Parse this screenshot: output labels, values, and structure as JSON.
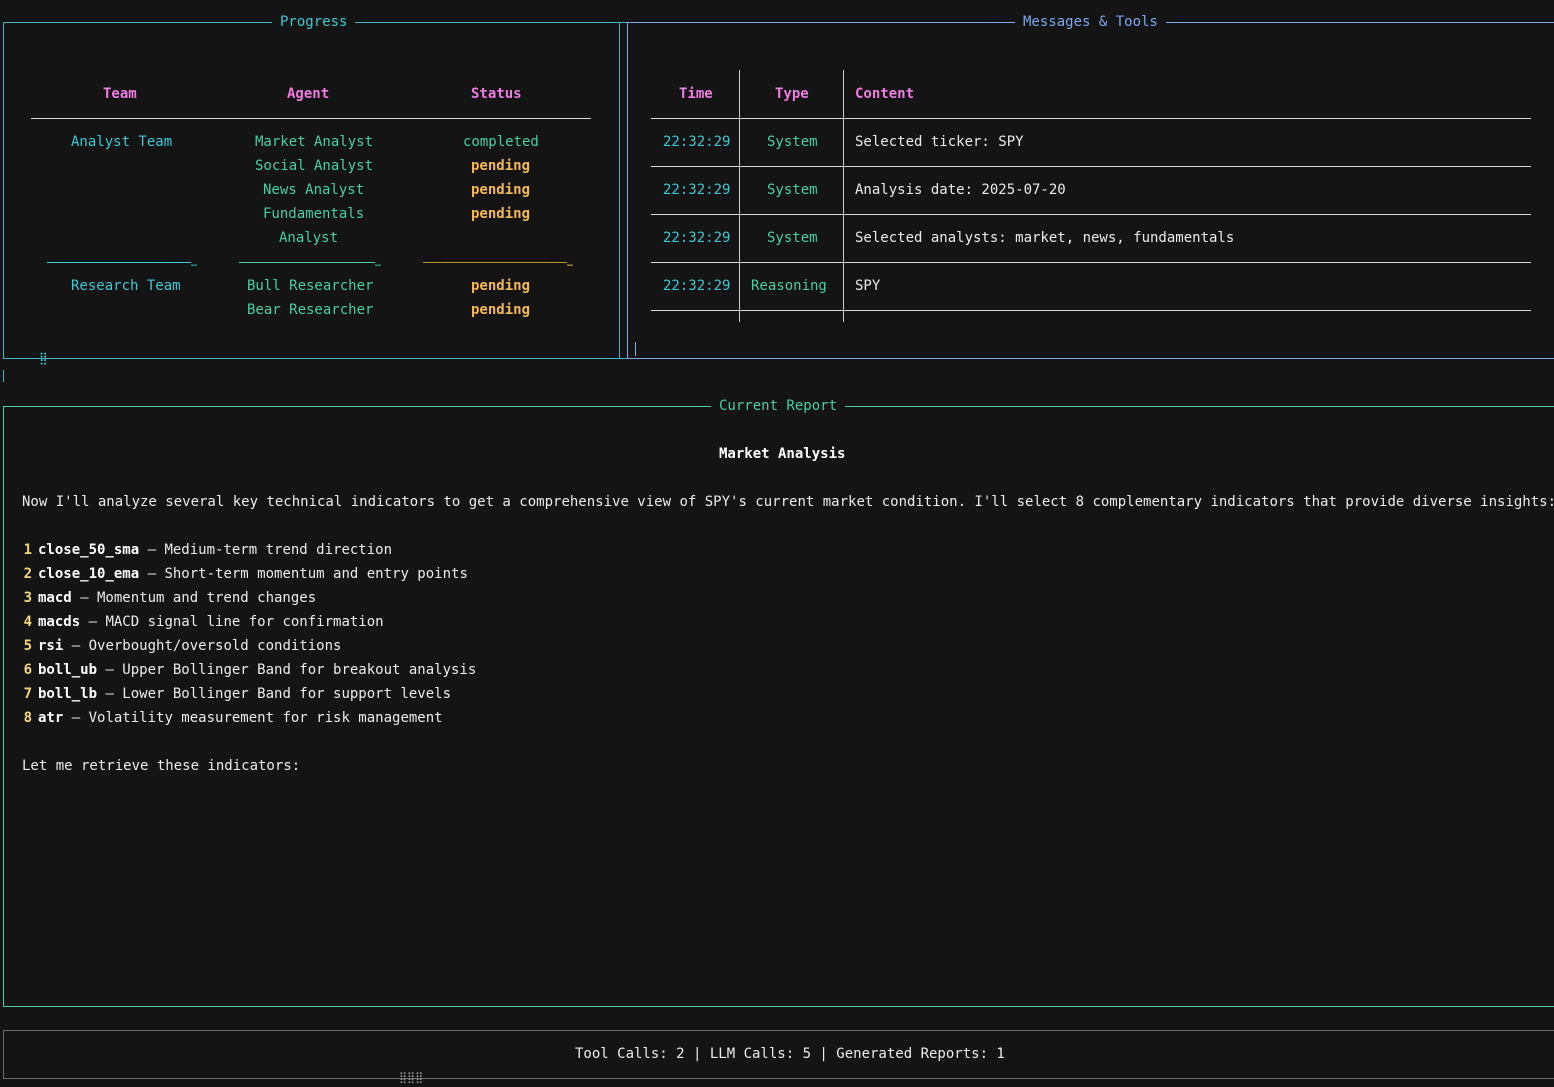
{
  "progress": {
    "title": "Progress",
    "headers": {
      "team": "Team",
      "agent": "Agent",
      "status": "Status"
    },
    "analyst_team": "Analyst Team",
    "research_team": "Research Team",
    "agents": [
      {
        "name": "Market Analyst",
        "status": "completed"
      },
      {
        "name": "Social Analyst",
        "status": "pending"
      },
      {
        "name": "News Analyst",
        "status": "pending"
      },
      {
        "name": "Fundamentals",
        "name2": "Analyst",
        "status": "pending"
      },
      {
        "name": "Bull Researcher",
        "status": "pending"
      },
      {
        "name": "Bear Researcher",
        "status": "pending"
      }
    ],
    "ellipsis": "…",
    "spinner": "⣿"
  },
  "messages": {
    "title": "Messages & Tools",
    "headers": {
      "time": "Time",
      "type": "Type",
      "content": "Content"
    },
    "rows": [
      {
        "time": "22:32:29",
        "type": "System",
        "content": "Selected ticker: SPY"
      },
      {
        "time": "22:32:29",
        "type": "System",
        "content": "Analysis date: 2025-07-20"
      },
      {
        "time": "22:32:29",
        "type": "System",
        "content": "Selected analysts: market, news, fundamentals"
      },
      {
        "time": "22:32:29",
        "type": "Reasoning",
        "content": "SPY"
      }
    ]
  },
  "report": {
    "title": "Current Report",
    "heading": "Market Analysis",
    "intro": "Now I'll analyze several key technical indicators to get a comprehensive view of SPY's current market condition. I'll select 8 complementary indicators that provide diverse insights:",
    "items": [
      {
        "num": "1",
        "key": "close_50_sma",
        "desc": " – Medium-term trend direction"
      },
      {
        "num": "2",
        "key": "close_10_ema",
        "desc": " – Short-term momentum and entry points"
      },
      {
        "num": "3",
        "key": "macd",
        "desc": " – Momentum and trend changes"
      },
      {
        "num": "4",
        "key": "macds",
        "desc": " – MACD signal line for confirmation"
      },
      {
        "num": "5",
        "key": "rsi",
        "desc": " – Overbought/oversold conditions"
      },
      {
        "num": "6",
        "key": "boll_ub",
        "desc": " – Upper Bollinger Band for breakout analysis"
      },
      {
        "num": "7",
        "key": "boll_lb",
        "desc": " – Lower Bollinger Band for support levels"
      },
      {
        "num": "8",
        "key": "atr",
        "desc": " – Volatility measurement for risk management"
      }
    ],
    "outro": "Let me retrieve these indicators:"
  },
  "footer": {
    "stats": "Tool Calls: 2 | LLM Calls: 5 | Generated Reports: 1",
    "spinner": "⣿⣿⣿"
  },
  "colors": {
    "background": "#141414",
    "border_cyan": "#3fb6c6",
    "border_green": "#48d0a0",
    "border_blue": "#7ba8f0",
    "header_pink": "#f07ce4",
    "status_completed": "#48d0a0",
    "status_pending": "#f5b950"
  }
}
